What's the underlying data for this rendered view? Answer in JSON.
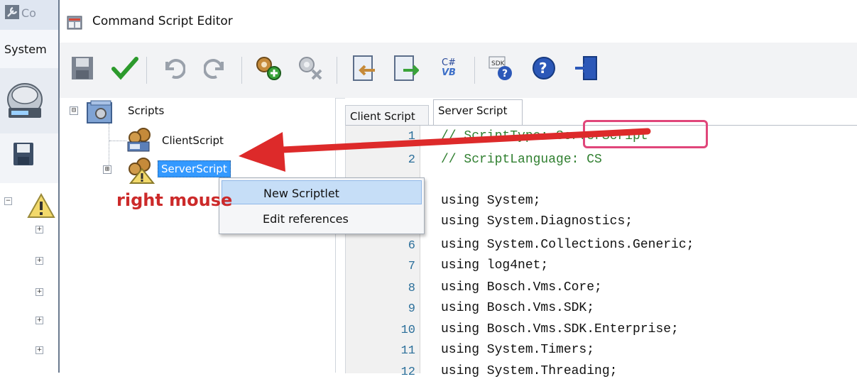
{
  "background_window": {
    "title": "Co",
    "menu_system": "System"
  },
  "editor_window": {
    "title": "Command Script Editor"
  },
  "toolbar": {
    "buttons": [
      "save-icon",
      "check-icon",
      "undo-icon",
      "redo-icon",
      "add-scriptlet-icon",
      "remove-scriptlet-icon",
      "import-icon",
      "export-icon",
      "convert-cs-vb-icon",
      "sdk-help-icon",
      "help-icon",
      "exit-icon"
    ],
    "convert_label_top": "C#",
    "convert_label_bottom": "VB",
    "sdk_label": "SDK"
  },
  "tree": {
    "root": "Scripts",
    "children": [
      "ClientScript",
      "ServerScript"
    ],
    "root_expander": "⊟",
    "child_expander": "⊞"
  },
  "context_menu": {
    "items": [
      "New Scriptlet",
      "Edit references"
    ]
  },
  "annotation": {
    "text": "right mouse",
    "color": "#cc2a2a",
    "highlight_color": "#e0467a"
  },
  "tabs": {
    "client": "Client Script",
    "server": "Server Script"
  },
  "code": {
    "lines": [
      {
        "n": "1",
        "text": "// ScriptType: ServerScript",
        "comment": true
      },
      {
        "n": "2",
        "text": "// ScriptLanguage: CS",
        "comment": true
      },
      {
        "n": "",
        "text": "",
        "comment": false
      },
      {
        "n": "",
        "text": "using System;",
        "comment": false
      },
      {
        "n": "",
        "text": "using System.Diagnostics;",
        "comment": false
      },
      {
        "n": "6",
        "text": "using System.Collections.Generic;",
        "comment": false
      },
      {
        "n": "7",
        "text": "using log4net;",
        "comment": false
      },
      {
        "n": "8",
        "text": "using Bosch.Vms.Core;",
        "comment": false
      },
      {
        "n": "9",
        "text": "using Bosch.Vms.SDK;",
        "comment": false
      },
      {
        "n": "10",
        "text": "using Bosch.Vms.SDK.Enterprise;",
        "comment": false
      },
      {
        "n": "11",
        "text": "using System.Timers;",
        "comment": false
      },
      {
        "n": "12",
        "text": "using System.Threading;",
        "comment": false
      }
    ]
  },
  "colors": {
    "selection": "#3399ff",
    "comment": "#2f7f2f",
    "line_number": "#2b6f9a"
  }
}
